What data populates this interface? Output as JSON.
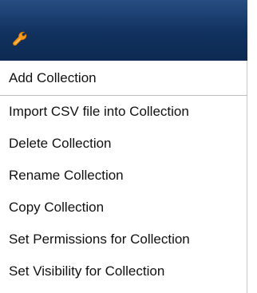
{
  "toolbar": {
    "icon": "wrench-icon",
    "icon_color": "#f39a1f",
    "background_color": "#17355f"
  },
  "menu": {
    "items": [
      {
        "label": "Add Collection"
      },
      {
        "label": "Import CSV file into Collection"
      },
      {
        "label": "Delete Collection"
      },
      {
        "label": "Rename Collection"
      },
      {
        "label": "Copy Collection"
      },
      {
        "label": "Set Permissions for Collection"
      },
      {
        "label": "Set Visibility for Collection"
      }
    ]
  }
}
